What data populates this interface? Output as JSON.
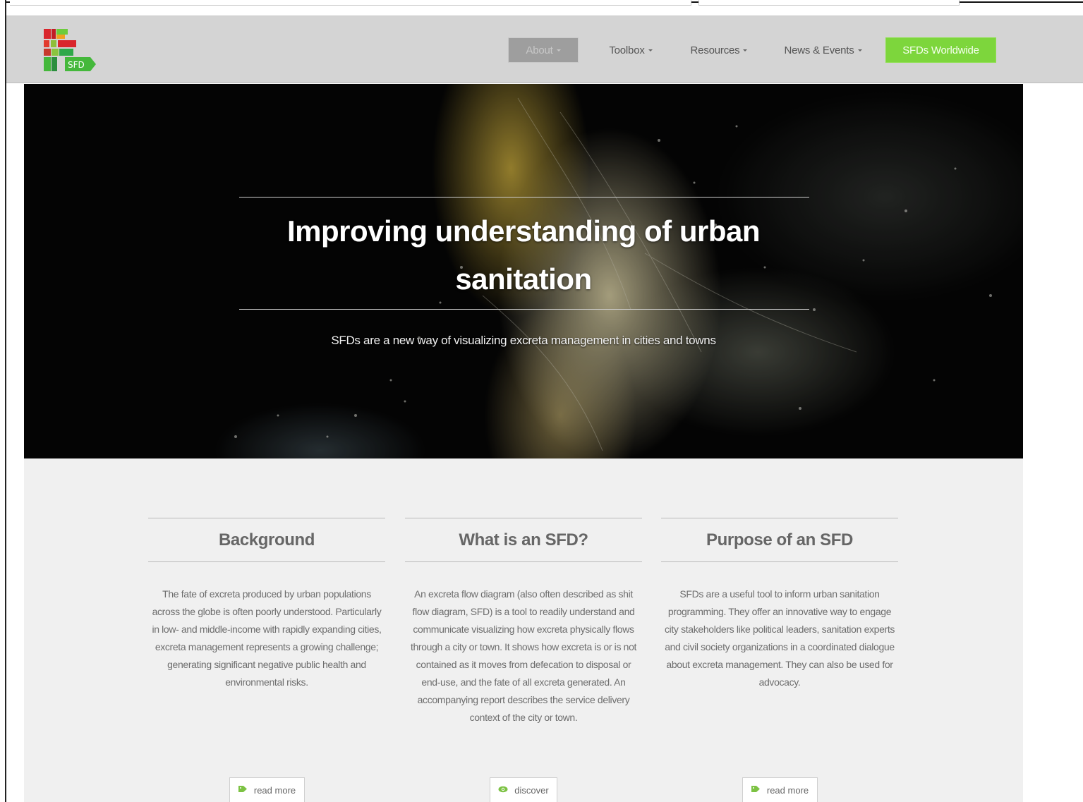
{
  "nav": {
    "logo_text": "SFD",
    "items": [
      {
        "label": "About",
        "has_dropdown": true,
        "active": true
      },
      {
        "label": "Toolbox",
        "has_dropdown": true
      },
      {
        "label": "Resources",
        "has_dropdown": true
      },
      {
        "label": "News & Events",
        "has_dropdown": true
      }
    ],
    "cta_label": "SFDs Worldwide"
  },
  "hero": {
    "title": "Improving understanding of urban sanitation",
    "subtitle": "SFDs are a new way of visualizing excreta management in cities and towns"
  },
  "columns": [
    {
      "title": "Background",
      "text": "The fate of excreta produced by urban populations across the globe is often poorly understood. Particularly in low- and middle-income with rapidly expanding cities, excreta management represents a growing challenge; generating significant negative public health and environmental risks.",
      "button_label": "read more",
      "button_icon": "tag-icon"
    },
    {
      "title": "What is an SFD?",
      "text": "An excreta flow diagram (also often described as shit flow diagram, SFD) is a tool to readily understand and communicate visualizing how excreta physically flows through a city or town. It shows how excreta is or is not contained as it moves from defecation to disposal or end-use, and the fate of all excreta generated. An accompanying report describes the service delivery context of the city or town.",
      "button_label": "discover",
      "button_icon": "eye-icon"
    },
    {
      "title": "Purpose of an SFD",
      "text": "SFDs are a useful tool to inform urban sanitation programming. They offer an innovative way to engage city stakeholders like political leaders, sanitation experts and civil society organizations in a coordinated dialogue about excreta management. They can also be used for advocacy.",
      "button_label": "read more",
      "button_icon": "tag-icon"
    }
  ],
  "colors": {
    "nav_bg": "#d4d4d4",
    "active_nav_bg": "#9e9e9e",
    "cta_green": "#7dd63c",
    "content_bg": "#f0f0f0",
    "icon_green": "#7cc243",
    "logo_red": "#d9262c",
    "logo_green": "#44b83b"
  }
}
